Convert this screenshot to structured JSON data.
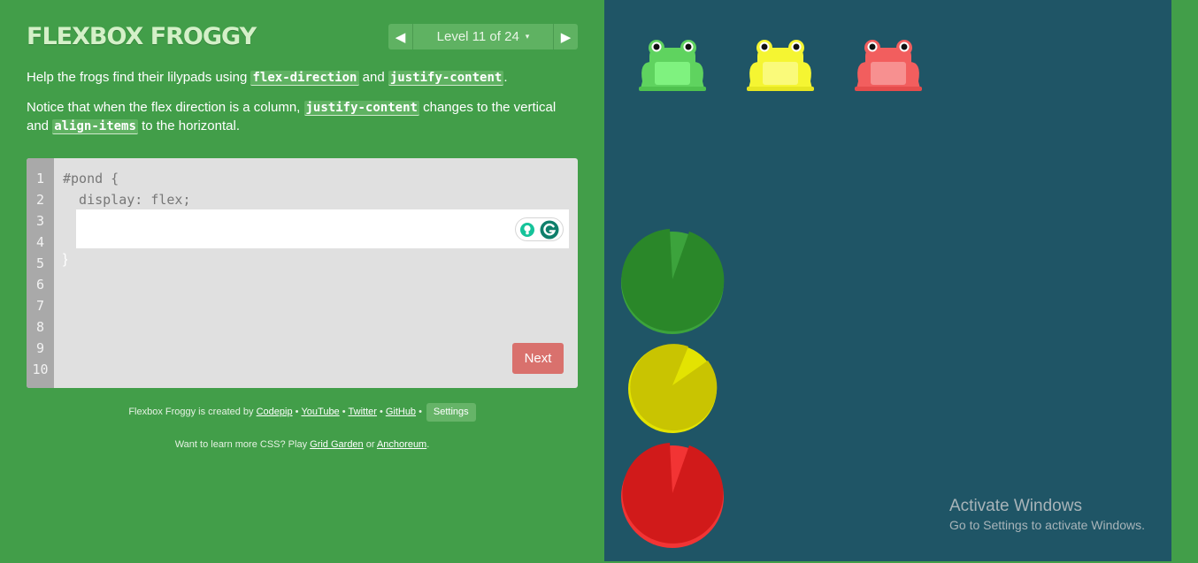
{
  "header": {
    "title": "FLEXBOX FROGGY",
    "level_label": "Level 11 of 24",
    "prev_arrow": "◀",
    "next_arrow": "▶",
    "caret": "▾"
  },
  "instructions": {
    "p1_before": "Help the frogs find their lilypads using ",
    "p1_code1": "flex-direction",
    "p1_mid": " and ",
    "p1_code2": "justify-content",
    "p1_after": ".",
    "p2_before": "Notice that when the flex direction is a column, ",
    "p2_code1": "justify-content",
    "p2_mid": " changes to the vertical and ",
    "p2_code2": "align-items",
    "p2_after": " to the horizontal."
  },
  "editor": {
    "line_numbers": [
      "1",
      "2",
      "3",
      "4",
      "5",
      "6",
      "7",
      "8",
      "9",
      "10"
    ],
    "line1": "#pond {",
    "line2": "  display: flex;",
    "closing": "}",
    "input_value": "",
    "next_label": "Next"
  },
  "footer": {
    "credit_prefix": "Flexbox Froggy is created by ",
    "codepip": "Codepip",
    "youtube": "YouTube",
    "twitter": "Twitter",
    "github": "GitHub",
    "bullet": "•",
    "settings": "Settings",
    "more_prefix": "Want to learn more CSS? Play ",
    "grid_garden": "Grid Garden",
    "or": " or ",
    "anchoreum": "Anchoreum",
    "more_suffix": "."
  },
  "frogs": [
    {
      "color": "green",
      "body": "#5fd35f",
      "belly": "#7ff27f"
    },
    {
      "color": "yellow",
      "body": "#f5f532",
      "belly": "#fafa7a"
    },
    {
      "color": "red",
      "body": "#f25e5e",
      "belly": "#f79090"
    }
  ],
  "lilypads": [
    {
      "color": "green",
      "fill": "#2a8729",
      "rim": "#3ca33c"
    },
    {
      "color": "yellow",
      "fill": "#c9c401",
      "rim": "#e3e302"
    },
    {
      "color": "red",
      "fill": "#d11a1a",
      "rim": "#f23434"
    }
  ],
  "watermark": {
    "title": "Activate Windows",
    "subtitle": "Go to Settings to activate Windows."
  },
  "colors": {
    "sidebar_bg": "#429e49",
    "pond_bg": "#1f5566",
    "next_button": "#d9716d",
    "code_highlight": "#5fb262"
  }
}
